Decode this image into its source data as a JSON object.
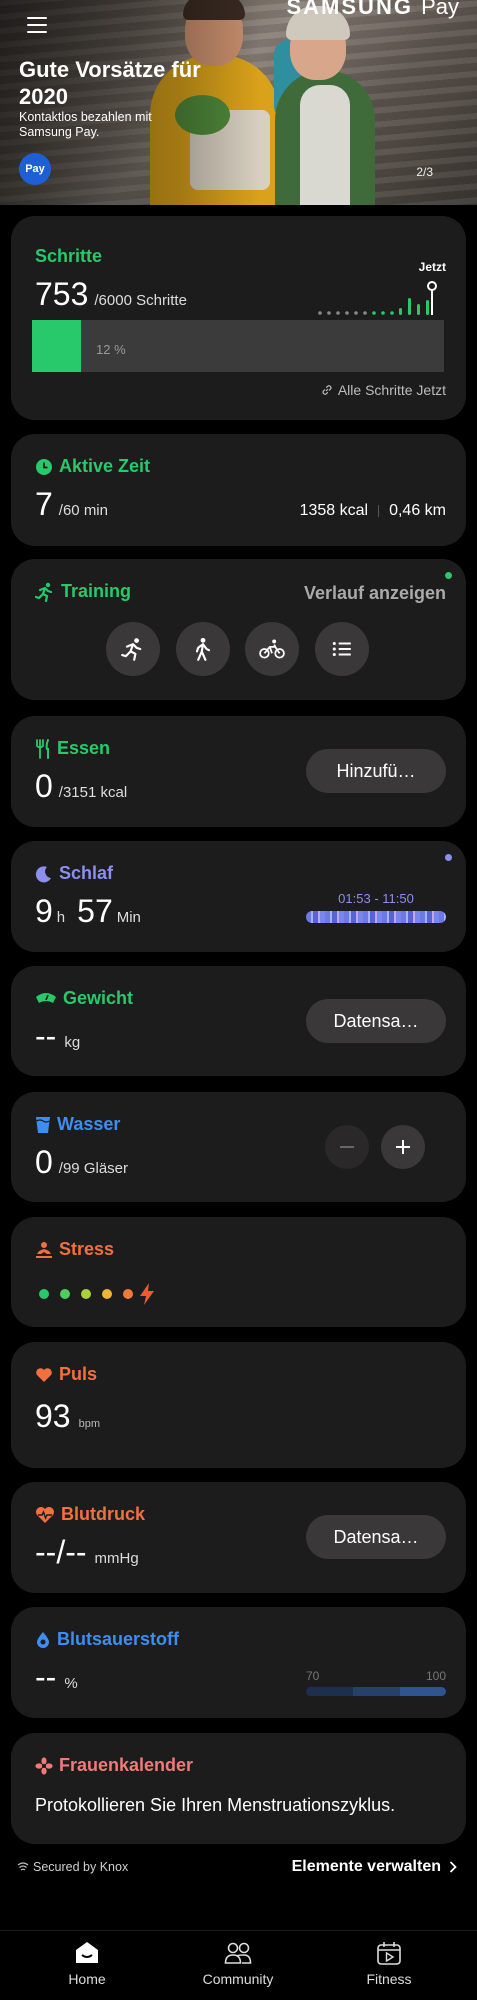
{
  "banner": {
    "brand": "SAMSUNG",
    "brand_pay": "Pay",
    "title": "Gute Vorsätze für 2020",
    "subtitle": "Kontaktlos bezahlen mit Samsung Pay.",
    "badge": "Pay",
    "pager": "2/3"
  },
  "steps": {
    "title": "Schritte",
    "value": "753",
    "goal": "/6000 Schritte",
    "now_label": "Jetzt",
    "progress_percent": 12,
    "progress_label": "12 %",
    "link": "Alle Schritte Jetzt",
    "accent": "#27c96a"
  },
  "active_time": {
    "title": "Aktive Zeit",
    "value": "7",
    "goal": "/60 min",
    "kcal": "1358 kcal",
    "distance": "0,46 km"
  },
  "training": {
    "title": "Training",
    "history": "Verlauf anzeigen",
    "buttons": [
      "running-icon",
      "walking-icon",
      "cycling-icon",
      "list-icon"
    ]
  },
  "food": {
    "title": "Essen",
    "value": "0",
    "goal": "/3151 kcal",
    "button": "Hinzufü…"
  },
  "sleep": {
    "title": "Schlaf",
    "hours": "9",
    "h_unit": "h",
    "minutes": "57",
    "min_unit": "Min",
    "range": "01:53 - 11:50",
    "accent": "#8a8ff0"
  },
  "weight": {
    "title": "Gewicht",
    "value": "--",
    "unit": "kg",
    "button": "Datensa…"
  },
  "water": {
    "title": "Wasser",
    "value": "0",
    "goal": "/99 Gläser",
    "accent": "#3d8ef0"
  },
  "stress": {
    "title": "Stress",
    "accent": "#f07040"
  },
  "pulse": {
    "title": "Puls",
    "value": "93",
    "unit": "bpm"
  },
  "blood_pressure": {
    "title": "Blutdruck",
    "value": "--/--",
    "unit": "mmHg",
    "button": "Datensa…"
  },
  "oxygen": {
    "title": "Blutsauerstoff",
    "value": "--",
    "unit": "%",
    "scale_min": "70",
    "scale_max": "100"
  },
  "women": {
    "title": "Frauenkalender",
    "text": "Protokollieren Sie Ihren Menstruationszyklus."
  },
  "footer": {
    "secured": "Secured by Knox",
    "manage": "Elemente verwalten"
  },
  "nav": {
    "home": "Home",
    "community": "Community",
    "fitness": "Fitness"
  }
}
